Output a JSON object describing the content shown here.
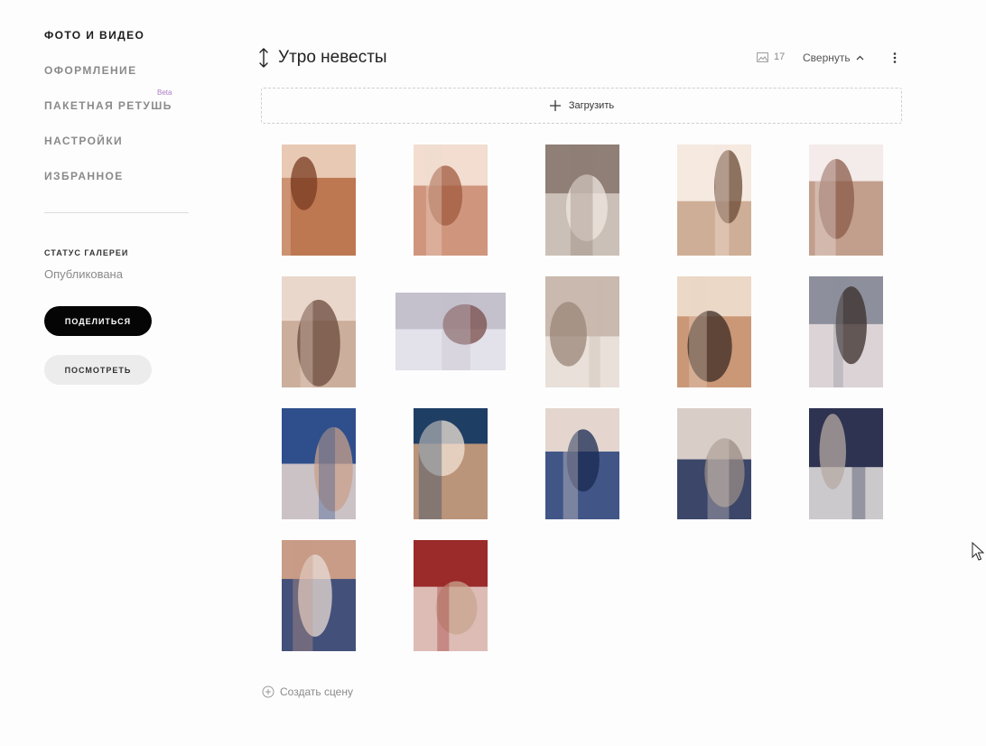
{
  "sidebar": {
    "nav": [
      {
        "label": "ФОТО И ВИДЕО",
        "active": true
      },
      {
        "label": "ОФОРМЛЕНИЕ",
        "active": false
      },
      {
        "label": "ПАКЕТНАЯ РЕТУШЬ",
        "active": false,
        "badge": "Beta"
      },
      {
        "label": "НАСТРОЙКИ",
        "active": false
      },
      {
        "label": "ИЗБРАННОЕ",
        "active": false
      }
    ],
    "status_label": "СТАТУС ГАЛЕРЕИ",
    "status_value": "Опубликована",
    "share_label": "ПОДЕЛИТЬСЯ",
    "view_label": "ПОСМОТРЕТЬ"
  },
  "scene": {
    "title": "Утро невесты",
    "count": "17",
    "collapse_label": "Свернуть"
  },
  "upload_label": "Загрузить",
  "create_scene_label": "Создать сцену",
  "colors": {
    "accent": "#050505",
    "beta": "#b07cc6",
    "muted": "#8a8a8a"
  },
  "photos": [
    {
      "subject": "mirror-shoes",
      "orientation": "portrait",
      "palette": [
        "#b5683f",
        "#e8c9b4",
        "#7a3b22"
      ]
    },
    {
      "subject": "dress-back-lace",
      "orientation": "portrait",
      "palette": [
        "#c98a6e",
        "#f2ddd0",
        "#a05a3f"
      ]
    },
    {
      "subject": "bride-mirror",
      "orientation": "portrait",
      "palette": [
        "#d6cbc3",
        "#8f7f76",
        "#efe7e1"
      ]
    },
    {
      "subject": "bride-smiling",
      "orientation": "portrait",
      "palette": [
        "#c7a388",
        "#f5e9e0",
        "#6b4a36"
      ]
    },
    {
      "subject": "dress-lacing",
      "orientation": "portrait",
      "palette": [
        "#b8927c",
        "#f4ecea",
        "#8b5b48"
      ]
    },
    {
      "subject": "flowers-mirror",
      "orientation": "portrait",
      "palette": [
        "#c6a793",
        "#ead7cb",
        "#6a4a3c"
      ]
    },
    {
      "subject": "shoes-floor",
      "orientation": "landscape",
      "palette": [
        "#e9e6ee",
        "#c4c0cc",
        "#7a4c4a"
      ]
    },
    {
      "subject": "bride-window",
      "orientation": "portrait",
      "palette": [
        "#efe6e0",
        "#c9b9ae",
        "#9b8678"
      ]
    },
    {
      "subject": "chair-shoes",
      "orientation": "portrait",
      "palette": [
        "#c48c68",
        "#ecd8c6",
        "#3a2a22"
      ]
    },
    {
      "subject": "groom-portrait",
      "orientation": "portrait",
      "palette": [
        "#e9dfe0",
        "#8d8f9c",
        "#3a2e2a"
      ]
    },
    {
      "subject": "hands-cufflinks",
      "orientation": "portrait",
      "palette": [
        "#e6d6d0",
        "#2e4f8c",
        "#c9a08b"
      ]
    },
    {
      "subject": "groom-suit-bed",
      "orientation": "portrait",
      "palette": [
        "#d7a47e",
        "#1f3e64",
        "#f2e3d6"
      ]
    },
    {
      "subject": "groom-tie",
      "orientation": "portrait",
      "palette": [
        "#243f7a",
        "#e4d6cf",
        "#1a2a52"
      ]
    },
    {
      "subject": "groom-jacket",
      "orientation": "portrait",
      "palette": [
        "#1f2e58",
        "#d9cdc8",
        "#9a8c86"
      ]
    },
    {
      "subject": "groom-mirror",
      "orientation": "portrait",
      "palette": [
        "#e9e4e2",
        "#2d3350",
        "#b5a9a3"
      ]
    },
    {
      "subject": "boutonniere",
      "orientation": "portrait",
      "palette": [
        "#2b4478",
        "#c89c86",
        "#e8dcd6"
      ]
    },
    {
      "subject": "rings-shoes",
      "orientation": "portrait",
      "palette": [
        "#e9d6cf",
        "#9b2a2a",
        "#c8a68f"
      ]
    }
  ]
}
